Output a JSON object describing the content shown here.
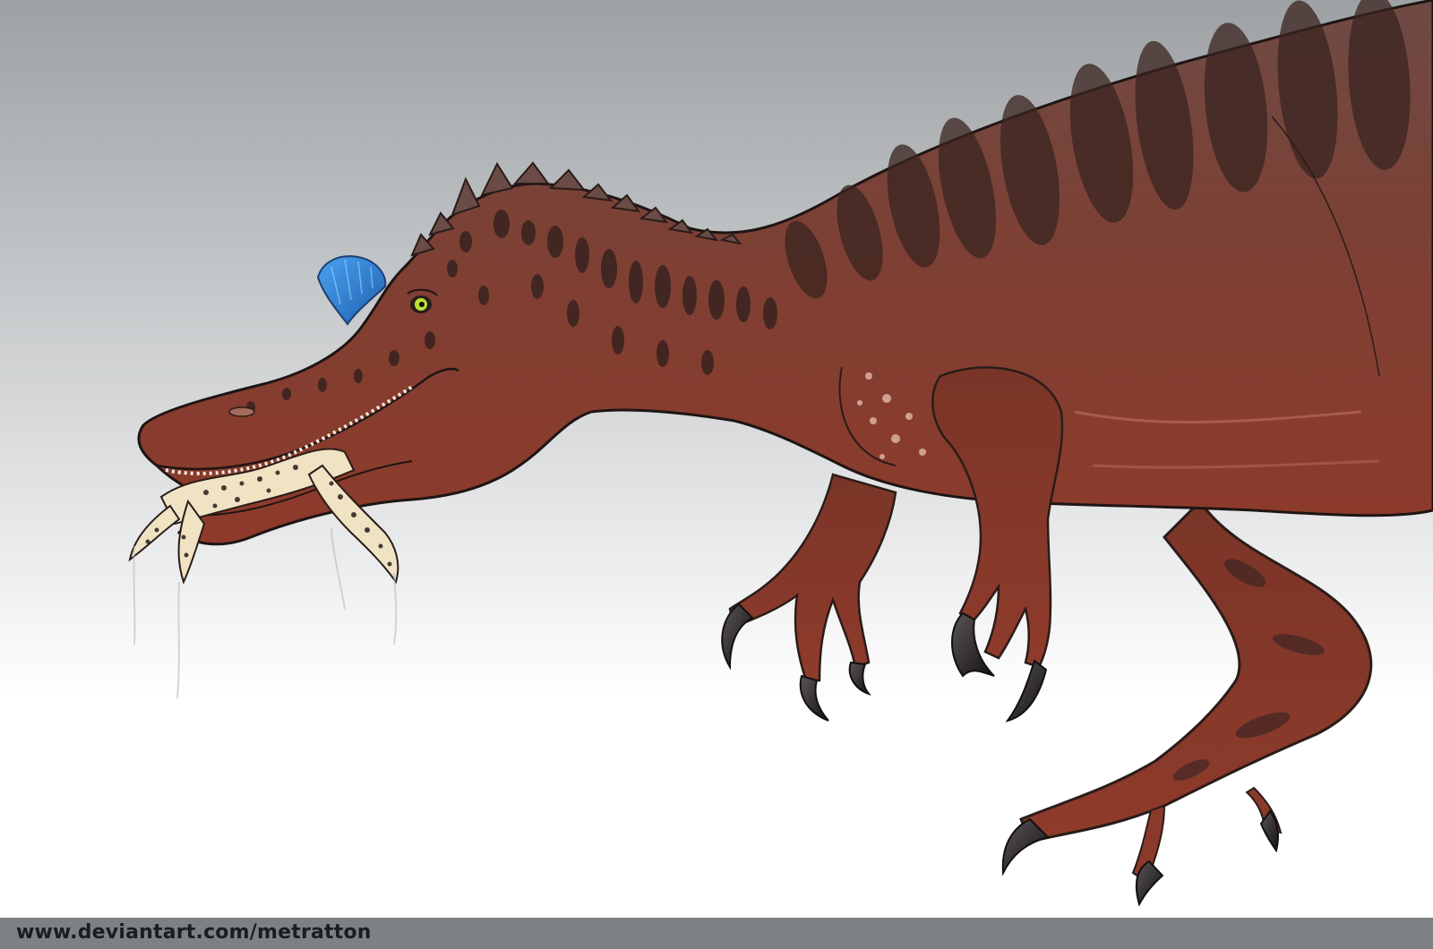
{
  "illustration": {
    "background_top_color": "#9ea1a3",
    "background_bottom_color": "#ffffff",
    "body_color": "#7a3a2d",
    "stripe_color": "#3a2420",
    "crest_color": "#2f82d2",
    "eye_color": "#b9e23a",
    "claw_color": "#1e1a1a",
    "prey_color": "#f0e3c4"
  },
  "footer": {
    "watermark_text": "www.deviantart.com/metratton",
    "background_color": "#7b8184"
  }
}
